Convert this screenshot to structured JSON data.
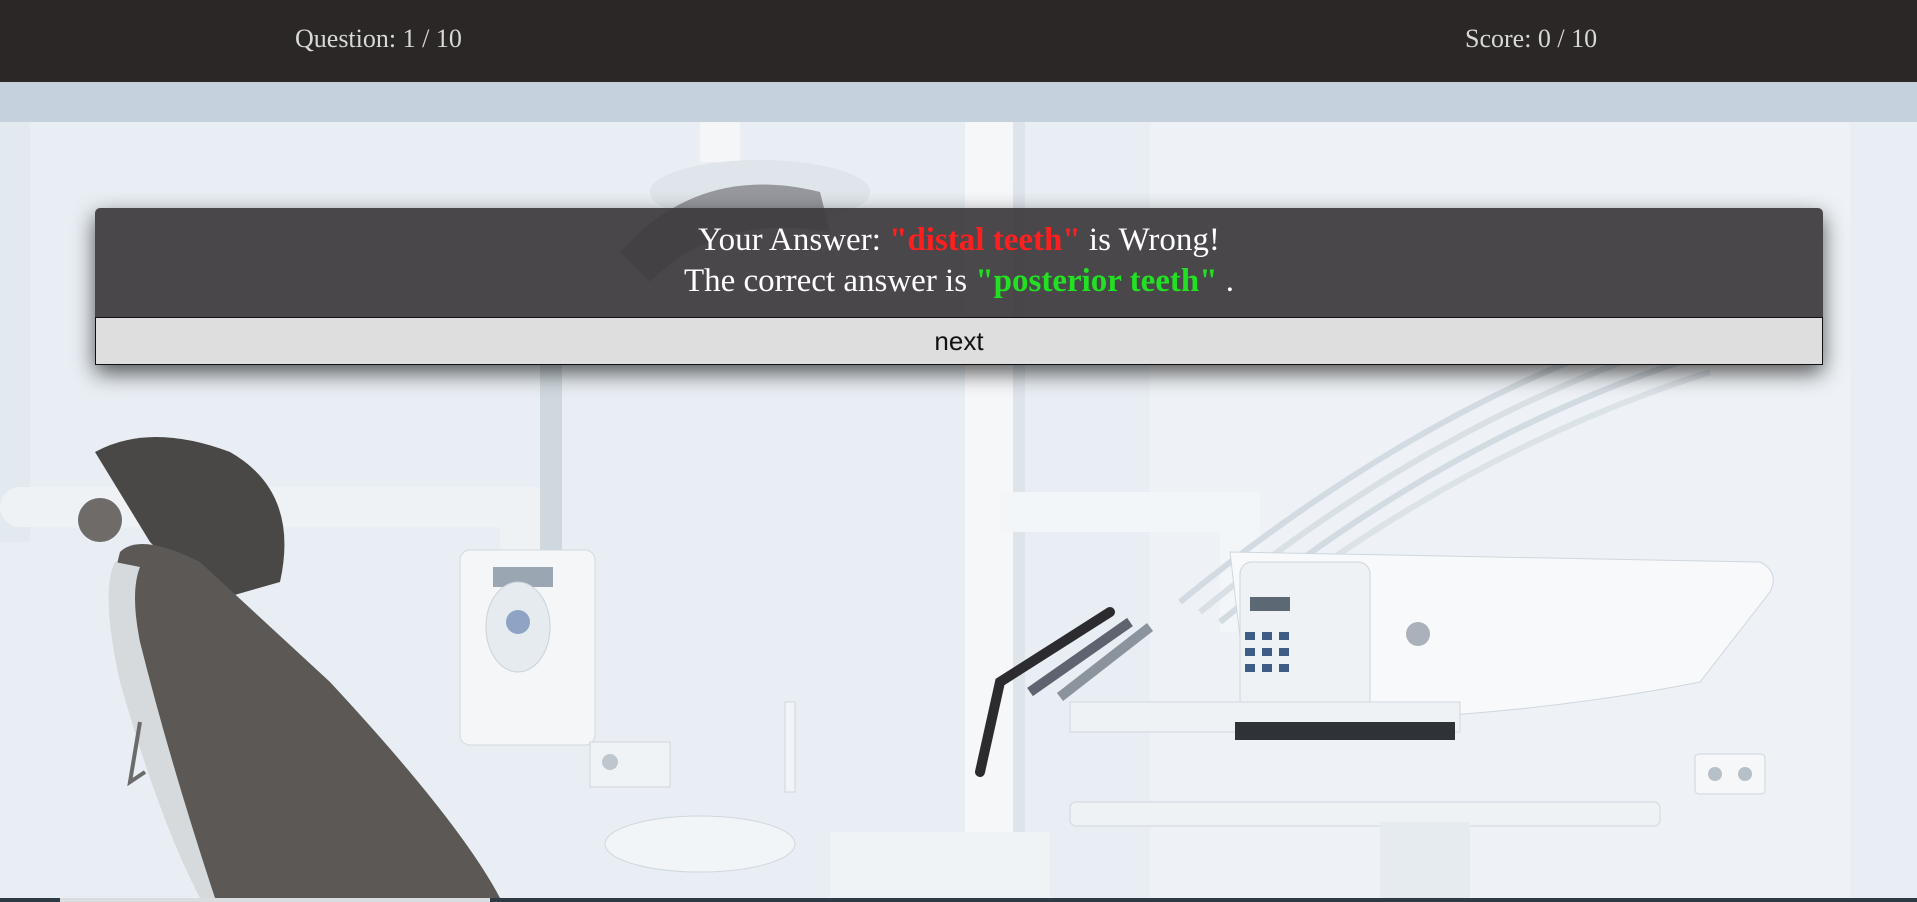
{
  "header": {
    "question_label": "Question: 1 / 10",
    "score_label": "Score: 0 / 10"
  },
  "feedback": {
    "answer_prefix": "Your Answer: ",
    "user_answer": "\"distal teeth\"",
    "answer_suffix": " is Wrong!",
    "correct_prefix": "The correct answer is ",
    "correct_answer": "\"posterior teeth\"",
    "correct_suffix": " .",
    "next_label": "next",
    "colors": {
      "wrong": "#ff1f1f",
      "correct": "#22e022"
    }
  },
  "background": {
    "description_icon": "dental-clinic-photo"
  }
}
